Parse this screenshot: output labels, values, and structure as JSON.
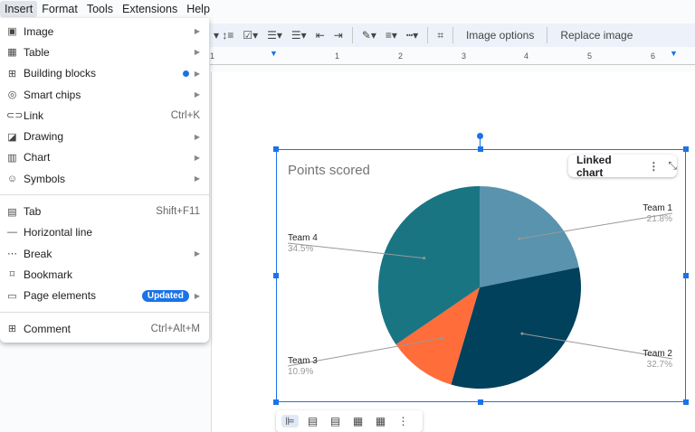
{
  "menubar": [
    "Insert",
    "Format",
    "Tools",
    "Extensions",
    "Help"
  ],
  "toolbar": {
    "image_options": "Image options",
    "replace_image": "Replace image"
  },
  "ruler": [
    "1",
    "1",
    "2",
    "3",
    "4",
    "5",
    "6"
  ],
  "menu": {
    "items": [
      {
        "label": "Image",
        "icon": "image-icon",
        "glyph": "▣",
        "arrow": true
      },
      {
        "label": "Table",
        "icon": "table-icon",
        "glyph": "▦",
        "arrow": true
      },
      {
        "label": "Building blocks",
        "icon": "building-blocks-icon",
        "glyph": "⊞",
        "arrow": true,
        "dot": true
      },
      {
        "label": "Smart chips",
        "icon": "smart-chips-icon",
        "glyph": "◎",
        "arrow": true
      },
      {
        "label": "Link",
        "icon": "link-icon",
        "glyph": "⊂⊃",
        "shortcut": "Ctrl+K"
      },
      {
        "label": "Drawing",
        "icon": "drawing-icon",
        "glyph": "◪",
        "arrow": true
      },
      {
        "label": "Chart",
        "icon": "chart-icon",
        "glyph": "▥",
        "arrow": true
      },
      {
        "label": "Symbols",
        "icon": "emoji-icon",
        "glyph": "☺",
        "arrow": true
      },
      {
        "sep": true
      },
      {
        "label": "Tab",
        "icon": "tab-icon",
        "glyph": "▤",
        "shortcut": "Shift+F11"
      },
      {
        "label": "Horizontal line",
        "icon": "horizontal-line-icon",
        "glyph": "—"
      },
      {
        "label": "Break",
        "icon": "break-icon",
        "glyph": "⋯",
        "arrow": true
      },
      {
        "label": "Bookmark",
        "icon": "bookmark-icon",
        "glyph": "⌑"
      },
      {
        "label": "Page elements",
        "icon": "page-elements-icon",
        "glyph": "▭",
        "arrow": true,
        "badge": "Updated"
      },
      {
        "sep": true
      },
      {
        "label": "Comment",
        "icon": "comment-icon",
        "glyph": "⊞",
        "shortcut": "Ctrl+Alt+M"
      }
    ]
  },
  "linked_chart": "Linked chart",
  "chart_data": {
    "type": "pie",
    "title": "Points scored",
    "categories": [
      "Team 1",
      "Team 2",
      "Team 3",
      "Team 4"
    ],
    "values": [
      21.8,
      32.7,
      10.9,
      34.5
    ],
    "labels": [
      "21.8%",
      "32.7%",
      "10.9%",
      "34.5%"
    ],
    "colors": [
      "#5a93ad",
      "#01415c",
      "#ff6d3b",
      "#1a7583"
    ]
  }
}
